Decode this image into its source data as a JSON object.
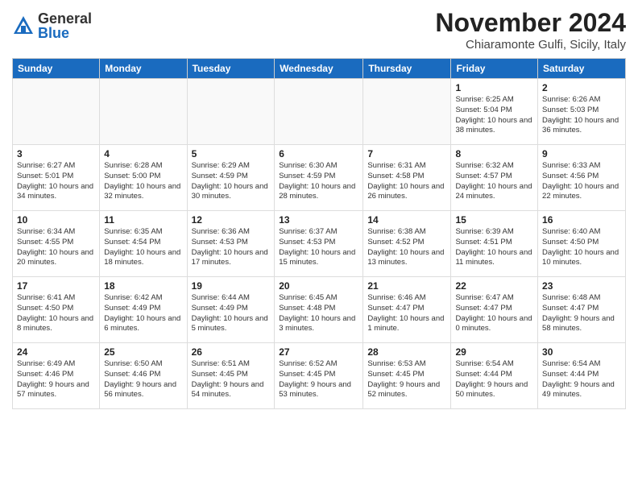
{
  "header": {
    "logo": {
      "general": "General",
      "blue": "Blue"
    },
    "title": "November 2024",
    "subtitle": "Chiaramonte Gulfi, Sicily, Italy"
  },
  "days_of_week": [
    "Sunday",
    "Monday",
    "Tuesday",
    "Wednesday",
    "Thursday",
    "Friday",
    "Saturday"
  ],
  "weeks": [
    [
      {
        "day": "",
        "info": ""
      },
      {
        "day": "",
        "info": ""
      },
      {
        "day": "",
        "info": ""
      },
      {
        "day": "",
        "info": ""
      },
      {
        "day": "",
        "info": ""
      },
      {
        "day": "1",
        "info": "Sunrise: 6:25 AM\nSunset: 5:04 PM\nDaylight: 10 hours and 38 minutes."
      },
      {
        "day": "2",
        "info": "Sunrise: 6:26 AM\nSunset: 5:03 PM\nDaylight: 10 hours and 36 minutes."
      }
    ],
    [
      {
        "day": "3",
        "info": "Sunrise: 6:27 AM\nSunset: 5:01 PM\nDaylight: 10 hours and 34 minutes."
      },
      {
        "day": "4",
        "info": "Sunrise: 6:28 AM\nSunset: 5:00 PM\nDaylight: 10 hours and 32 minutes."
      },
      {
        "day": "5",
        "info": "Sunrise: 6:29 AM\nSunset: 4:59 PM\nDaylight: 10 hours and 30 minutes."
      },
      {
        "day": "6",
        "info": "Sunrise: 6:30 AM\nSunset: 4:59 PM\nDaylight: 10 hours and 28 minutes."
      },
      {
        "day": "7",
        "info": "Sunrise: 6:31 AM\nSunset: 4:58 PM\nDaylight: 10 hours and 26 minutes."
      },
      {
        "day": "8",
        "info": "Sunrise: 6:32 AM\nSunset: 4:57 PM\nDaylight: 10 hours and 24 minutes."
      },
      {
        "day": "9",
        "info": "Sunrise: 6:33 AM\nSunset: 4:56 PM\nDaylight: 10 hours and 22 minutes."
      }
    ],
    [
      {
        "day": "10",
        "info": "Sunrise: 6:34 AM\nSunset: 4:55 PM\nDaylight: 10 hours and 20 minutes."
      },
      {
        "day": "11",
        "info": "Sunrise: 6:35 AM\nSunset: 4:54 PM\nDaylight: 10 hours and 18 minutes."
      },
      {
        "day": "12",
        "info": "Sunrise: 6:36 AM\nSunset: 4:53 PM\nDaylight: 10 hours and 17 minutes."
      },
      {
        "day": "13",
        "info": "Sunrise: 6:37 AM\nSunset: 4:53 PM\nDaylight: 10 hours and 15 minutes."
      },
      {
        "day": "14",
        "info": "Sunrise: 6:38 AM\nSunset: 4:52 PM\nDaylight: 10 hours and 13 minutes."
      },
      {
        "day": "15",
        "info": "Sunrise: 6:39 AM\nSunset: 4:51 PM\nDaylight: 10 hours and 11 minutes."
      },
      {
        "day": "16",
        "info": "Sunrise: 6:40 AM\nSunset: 4:50 PM\nDaylight: 10 hours and 10 minutes."
      }
    ],
    [
      {
        "day": "17",
        "info": "Sunrise: 6:41 AM\nSunset: 4:50 PM\nDaylight: 10 hours and 8 minutes."
      },
      {
        "day": "18",
        "info": "Sunrise: 6:42 AM\nSunset: 4:49 PM\nDaylight: 10 hours and 6 minutes."
      },
      {
        "day": "19",
        "info": "Sunrise: 6:44 AM\nSunset: 4:49 PM\nDaylight: 10 hours and 5 minutes."
      },
      {
        "day": "20",
        "info": "Sunrise: 6:45 AM\nSunset: 4:48 PM\nDaylight: 10 hours and 3 minutes."
      },
      {
        "day": "21",
        "info": "Sunrise: 6:46 AM\nSunset: 4:47 PM\nDaylight: 10 hours and 1 minute."
      },
      {
        "day": "22",
        "info": "Sunrise: 6:47 AM\nSunset: 4:47 PM\nDaylight: 10 hours and 0 minutes."
      },
      {
        "day": "23",
        "info": "Sunrise: 6:48 AM\nSunset: 4:47 PM\nDaylight: 9 hours and 58 minutes."
      }
    ],
    [
      {
        "day": "24",
        "info": "Sunrise: 6:49 AM\nSunset: 4:46 PM\nDaylight: 9 hours and 57 minutes."
      },
      {
        "day": "25",
        "info": "Sunrise: 6:50 AM\nSunset: 4:46 PM\nDaylight: 9 hours and 56 minutes."
      },
      {
        "day": "26",
        "info": "Sunrise: 6:51 AM\nSunset: 4:45 PM\nDaylight: 9 hours and 54 minutes."
      },
      {
        "day": "27",
        "info": "Sunrise: 6:52 AM\nSunset: 4:45 PM\nDaylight: 9 hours and 53 minutes."
      },
      {
        "day": "28",
        "info": "Sunrise: 6:53 AM\nSunset: 4:45 PM\nDaylight: 9 hours and 52 minutes."
      },
      {
        "day": "29",
        "info": "Sunrise: 6:54 AM\nSunset: 4:44 PM\nDaylight: 9 hours and 50 minutes."
      },
      {
        "day": "30",
        "info": "Sunrise: 6:54 AM\nSunset: 4:44 PM\nDaylight: 9 hours and 49 minutes."
      }
    ]
  ]
}
